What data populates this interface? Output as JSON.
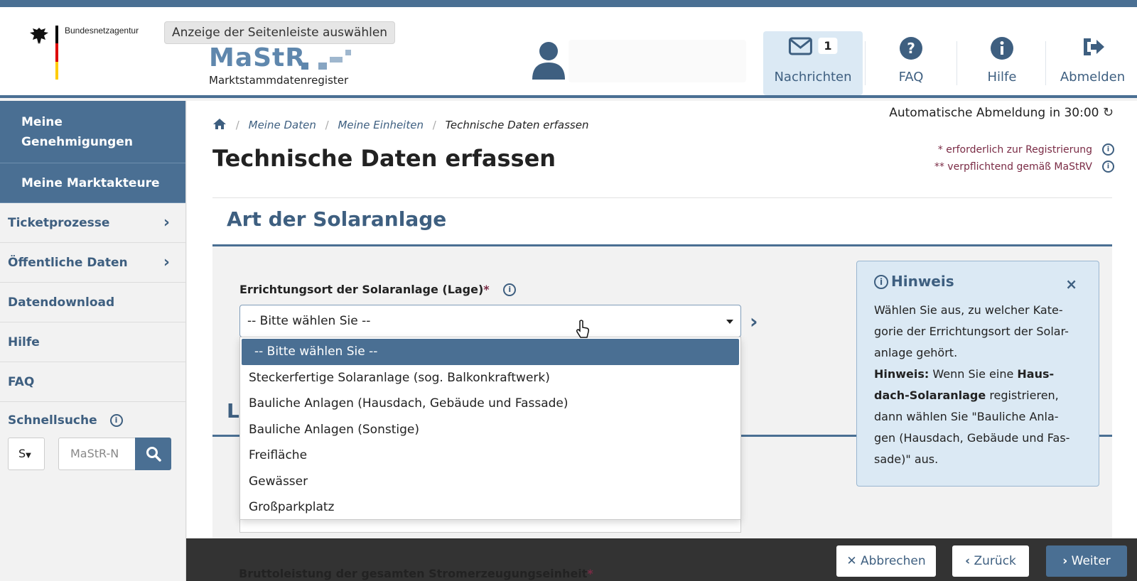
{
  "header": {
    "agency": "Bundesnetzagentur",
    "tooltip": "Anzeige der Seitenleiste auswählen",
    "logo_title": "MaStR",
    "logo_subtitle": "Marktstammdatenregister",
    "messages_label": "Nachrichten",
    "messages_count": "1",
    "faq_label": "FAQ",
    "help_label": "Hilfe",
    "logout_label": "Abmelden"
  },
  "sidebar": {
    "items_dark": [
      "Meine Genehmigungen",
      "Meine Marktakteure"
    ],
    "items": [
      {
        "label": "Ticketprozesse",
        "chevron": true
      },
      {
        "label": "Öffentliche Daten",
        "chevron": true
      },
      {
        "label": "Datendownload",
        "chevron": false
      },
      {
        "label": "Hilfe",
        "chevron": false
      },
      {
        "label": "FAQ",
        "chevron": false
      }
    ],
    "quicksearch_label": "Schnellsuche",
    "quicksearch_type": "S",
    "quicksearch_placeholder": "MaStR-N"
  },
  "main": {
    "auto_logout": "Automatische Abmeldung in 30:00",
    "breadcrumbs": [
      "Meine Daten",
      "Meine Einheiten",
      "Technische Daten erfassen"
    ],
    "title": "Technische Daten erfassen",
    "legend_required": "* erforderlich zur Registrierung",
    "legend_mandatory": "** verpflichtend gemäß MaStRV",
    "section_title": "Art der Solaranlage",
    "section2_title": "L",
    "field_label": "Errichtungsort der Solaranlage (Lage)",
    "field_value": "-- Bitte wählen Sie --",
    "dropdown_options": [
      "-- Bitte wählen Sie --",
      "Steckerfertige Solaranlage (sog. Balkonkraftwerk)",
      "Bauliche Anlagen (Hausdach, Gebäude und Fassade)",
      "Bauliche Anlagen (Sonstige)",
      "Freifläche",
      "Gewässer",
      "Großparkplatz"
    ],
    "bottom_field_label": "Bruttoleistung der gesamten Stromerzeugungseinheit"
  },
  "hint": {
    "title": "Hinweis",
    "line1": "Wählen Sie aus, zu welcher Kate-",
    "line2": "gorie der Errichtungsort der Solar-",
    "line3": "anlage gehört.",
    "bold_label": "Hinweis:",
    "line4_a": " Wenn Sie eine ",
    "line4_b": "Haus-",
    "line5_a": "dach-Solaranlage",
    "line5_b": " registrieren,",
    "line6": "dann wählen Sie \"Bauliche Anla-",
    "line7": "gen (Hausdach, Gebäude und Fas-",
    "line8": "sade)\" aus."
  },
  "footer": {
    "cancel": "Abbrechen",
    "back": "Zurück",
    "next": "Weiter"
  },
  "colors": {
    "primary": "#4a6f93",
    "hint_bg": "#dbe9f4",
    "required": "#7a2b45"
  }
}
